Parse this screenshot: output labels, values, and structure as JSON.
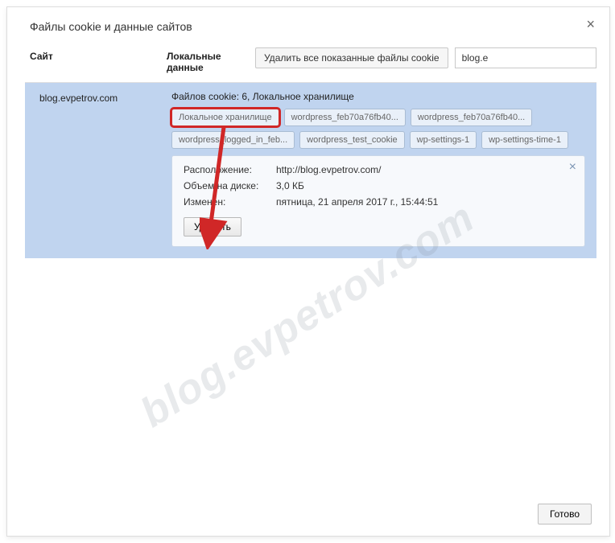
{
  "dialog": {
    "title": "Файлы cookie и данные сайтов",
    "columns": {
      "site": "Сайт",
      "local_data": "Локальные данные"
    },
    "delete_all_label": "Удалить все показанные файлы cookie",
    "search_value": "blog.e",
    "done_label": "Готово"
  },
  "site": {
    "domain": "blog.evpetrov.com",
    "summary": "Файлов cookie: 6, Локальное хранилище",
    "chips": [
      "Локальное хранилище",
      "wordpress_feb70a76fb40...",
      "wordpress_feb70a76fb40...",
      "wordpress_logged_in_feb...",
      "wordpress_test_cookie",
      "wp-settings-1",
      "wp-settings-time-1"
    ],
    "highlight_index": 0
  },
  "detail": {
    "rows": [
      {
        "label": "Расположение:",
        "value": "http://blog.evpetrov.com/"
      },
      {
        "label": "Объем на диске:",
        "value": "3,0 КБ"
      },
      {
        "label": "Изменен:",
        "value": "пятница, 21 апреля 2017 г., 15:44:51"
      }
    ],
    "delete_label": "Удалить"
  },
  "watermark": "blog.evpetrov.com"
}
